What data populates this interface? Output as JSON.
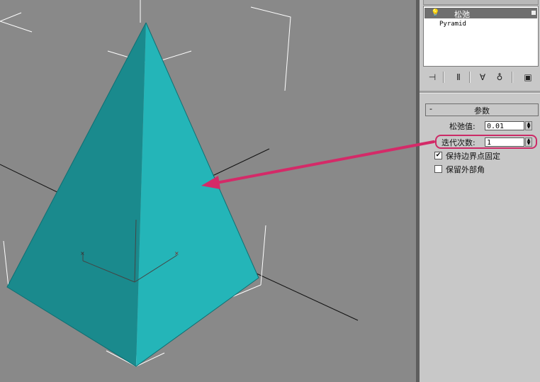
{
  "modifier_stack": {
    "active_modifier": "松弛",
    "base_object": "Pyramid"
  },
  "parameters_rollout": {
    "title": "参数",
    "collapse_symbol": "-",
    "relax_value_label": "松弛值:",
    "relax_value": "0.01",
    "iterations_label": "迭代次数:",
    "iterations": "1",
    "keep_boundary_label": "保持边界点固定",
    "keep_boundary_checked": true,
    "save_outer_corners_label": "保留外部角",
    "save_outer_corners_checked": false
  },
  "colors": {
    "pyramid_light": "#24b5b8",
    "pyramid_dark": "#1a8a8d",
    "annotation": "#d42a68",
    "viewport_bg": "#898989",
    "panel_bg": "#c8c8c8"
  },
  "icons": [
    "bulb-icon",
    "pin-stack-icon",
    "show-end-result-icon",
    "make-unique-icon",
    "remove-modifier-icon",
    "configure-modifier-sets-icon"
  ]
}
